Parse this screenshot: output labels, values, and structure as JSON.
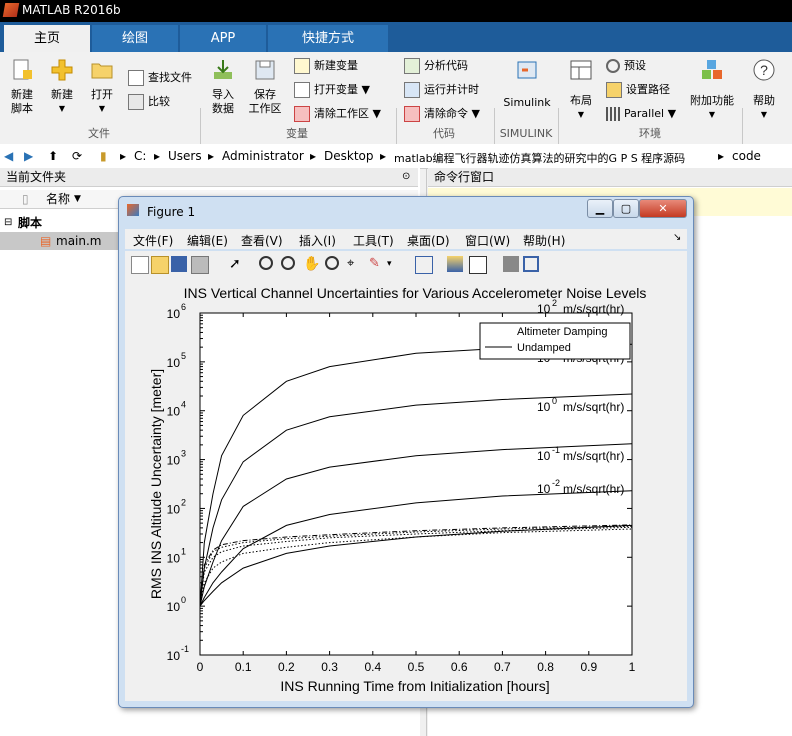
{
  "app": {
    "title": "MATLAB R2016b"
  },
  "tabs": [
    {
      "label": "主页"
    },
    {
      "label": "绘图"
    },
    {
      "label": "APP"
    },
    {
      "label": "快捷方式"
    }
  ],
  "ribbon": {
    "new_script": "新建\n脚本",
    "new": "新建",
    "open": "打开",
    "find_files": "查找文件",
    "compare": "比较",
    "import": "导入\n数据",
    "save_ws": "保存\n工作区",
    "new_var": "新建变量",
    "open_var": "打开变量",
    "clear_ws": "清除工作区",
    "analyze": "分析代码",
    "run_time": "运行并计时",
    "clear_cmd": "清除命令",
    "simulink": "Simulink",
    "layout": "布局",
    "prefs": "预设",
    "set_path": "设置路径",
    "parallel": "Parallel",
    "addons": "附加功能",
    "help": "帮助",
    "sections": [
      "文件",
      "变量",
      "代码",
      "SIMULINK",
      "环境"
    ]
  },
  "address": {
    "parts": [
      "C:",
      "Users",
      "Administrator",
      "Desktop",
      "matlab编程飞行器轨迹仿真算法的研究中的G P S 程序源码",
      "code"
    ]
  },
  "current_folder": {
    "title": "当前文件夹",
    "col_name": "名称",
    "group": "脚本",
    "file": "main.m"
  },
  "command_window": {
    "title": "命令行窗口"
  },
  "figure": {
    "title": "Figure 1",
    "menu": [
      "文件(F)",
      "编辑(E)",
      "查看(V)",
      "插入(I)",
      "工具(T)",
      "桌面(D)",
      "窗口(W)",
      "帮助(H)"
    ]
  },
  "chart_data": {
    "type": "line",
    "title": "INS Vertical Channel Uncertainties for Various Accelerometer Noise Levels",
    "xlabel": "INS Running Time from Initialization [hours]",
    "ylabel": "RMS INS Altitude Uncertainty [meter]",
    "xlim": [
      0,
      1
    ],
    "ylim": [
      0.1,
      1000000
    ],
    "yscale": "log",
    "x_ticks": [
      "0",
      "0.1",
      "0.2",
      "0.3",
      "0.4",
      "0.5",
      "0.6",
      "0.7",
      "0.8",
      "0.9",
      "1"
    ],
    "y_ticks": [
      {
        "base": "10",
        "exp": "-1"
      },
      {
        "base": "10",
        "exp": "0"
      },
      {
        "base": "10",
        "exp": "1"
      },
      {
        "base": "10",
        "exp": "2"
      },
      {
        "base": "10",
        "exp": "3"
      },
      {
        "base": "10",
        "exp": "4"
      },
      {
        "base": "10",
        "exp": "5"
      },
      {
        "base": "10",
        "exp": "6"
      }
    ],
    "legend": {
      "location": "top-right",
      "entries": [
        "Altimeter Damping",
        "Undamped"
      ]
    },
    "annotations": [
      {
        "base": "10",
        "exp": "2",
        "suffix": " m/s/sqrt(hr)"
      },
      {
        "base": "10",
        "exp": "1",
        "suffix": " m/s/sqrt(hr)"
      },
      {
        "base": "10",
        "exp": "0",
        "suffix": " m/s/sqrt(hr)"
      },
      {
        "base": "10",
        "exp": "-1",
        "suffix": " m/s/sqrt(hr)"
      },
      {
        "base": "10",
        "exp": "-2",
        "suffix": " m/s/sqrt(hr)"
      }
    ],
    "series": [
      {
        "style": "solid",
        "x": [
          0,
          0.01,
          0.03,
          0.05,
          0.1,
          0.2,
          0.3,
          0.5,
          0.7,
          1.0
        ],
        "y": [
          1,
          20,
          200,
          1200,
          8000,
          40000,
          80000,
          150000,
          190000,
          230000
        ]
      },
      {
        "style": "solid",
        "x": [
          0,
          0.01,
          0.03,
          0.05,
          0.1,
          0.2,
          0.3,
          0.5,
          0.7,
          1.0
        ],
        "y": [
          1,
          6,
          40,
          150,
          900,
          4000,
          7500,
          13000,
          17000,
          22000
        ]
      },
      {
        "style": "solid",
        "x": [
          0,
          0.01,
          0.03,
          0.05,
          0.1,
          0.2,
          0.3,
          0.5,
          0.7,
          1.0
        ],
        "y": [
          1,
          2.5,
          8,
          22,
          110,
          400,
          700,
          1200,
          1600,
          2100
        ]
      },
      {
        "style": "solid",
        "x": [
          0,
          0.01,
          0.03,
          0.05,
          0.1,
          0.2,
          0.3,
          0.5,
          0.7,
          1.0
        ],
        "y": [
          1,
          1.5,
          3,
          5,
          15,
          45,
          75,
          130,
          180,
          230
        ]
      },
      {
        "style": "solid",
        "x": [
          0,
          0.01,
          0.03,
          0.05,
          0.1,
          0.2,
          0.3,
          0.5,
          0.7,
          1.0
        ],
        "y": [
          1,
          1.3,
          2,
          3,
          6,
          12,
          17,
          26,
          34,
          45
        ]
      },
      {
        "style": "dotted",
        "x": [
          0,
          0.01,
          0.03,
          0.05,
          0.1,
          0.2,
          0.3,
          0.5,
          0.7,
          1.0
        ],
        "y": [
          1,
          3,
          6,
          8,
          12,
          16,
          20,
          26,
          32,
          38
        ]
      },
      {
        "style": "dotted",
        "x": [
          0,
          0.01,
          0.03,
          0.05,
          0.1,
          0.2,
          0.3,
          0.5,
          0.7,
          1.0
        ],
        "y": [
          1,
          5,
          10,
          13,
          17,
          21,
          25,
          30,
          35,
          41
        ]
      },
      {
        "style": "dotted",
        "x": [
          0,
          0.01,
          0.03,
          0.05,
          0.1,
          0.2,
          0.3,
          0.5,
          0.7,
          1.0
        ],
        "y": [
          1,
          6,
          13,
          16,
          20,
          24,
          27,
          33,
          38,
          43
        ]
      },
      {
        "style": "dashdot",
        "x": [
          0,
          0.01,
          0.03,
          0.05,
          0.1,
          0.2,
          0.3,
          0.5,
          0.7,
          1.0
        ],
        "y": [
          1,
          7,
          14,
          18,
          22,
          26,
          29,
          35,
          40,
          46
        ]
      }
    ]
  }
}
